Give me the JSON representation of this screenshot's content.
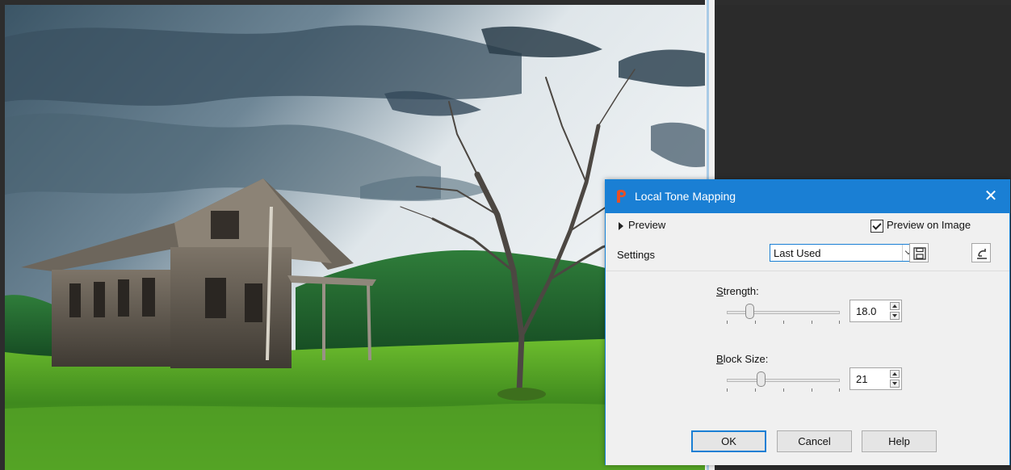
{
  "dialog": {
    "title": "Local Tone Mapping",
    "close_glyph": "✕",
    "preview_label": "Preview",
    "preview_on_image_label": "Preview on Image",
    "preview_on_image_checked": true,
    "settings_label": "Settings",
    "preset_value": "Last Used",
    "strength": {
      "label_underlined": "S",
      "label_rest": "trength:",
      "value": "18.0",
      "level": 0.18
    },
    "block_size": {
      "label_underlined": "B",
      "label_rest": "lock Size:",
      "value": "21",
      "level": 0.29
    },
    "buttons": {
      "ok": "OK",
      "cancel": "Cancel",
      "help": "Help"
    },
    "icons": [
      "app-logo-icon",
      "close-icon",
      "triangle-right-icon",
      "checkbox-icon",
      "chevron-down-icon",
      "save-preset-icon",
      "reset-icon",
      "spin-up-icon",
      "spin-down-icon"
    ]
  },
  "colors": {
    "titlebar": "#1a7fd4",
    "dialog_bg": "#f0f0f0",
    "app_bg": "#2d2d2d"
  }
}
